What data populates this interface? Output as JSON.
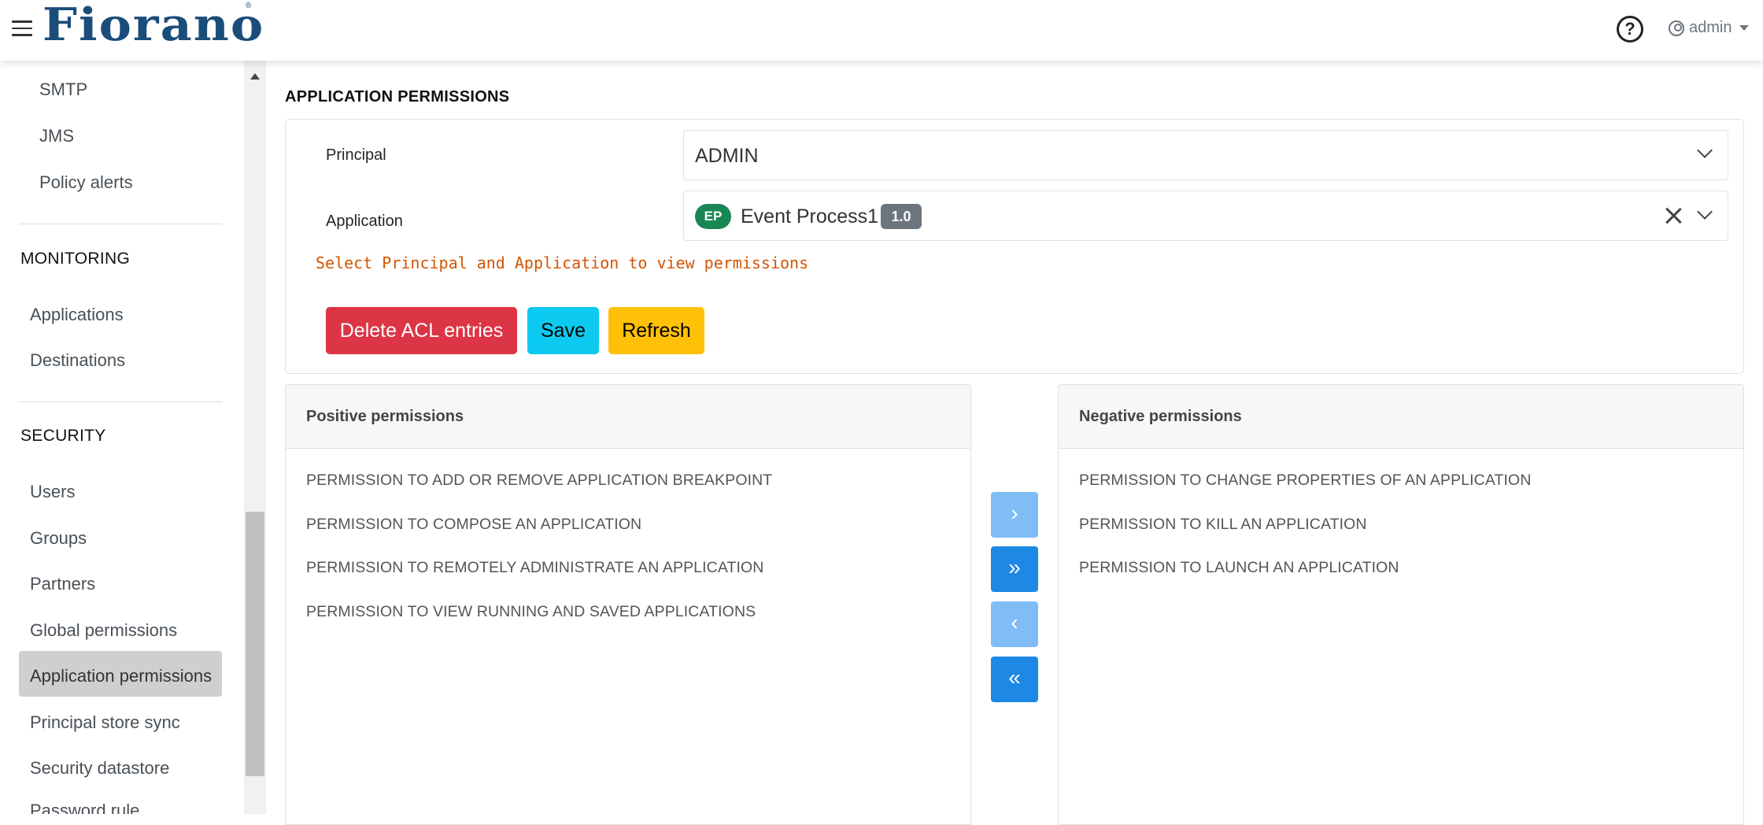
{
  "header": {
    "logo_text": "Fiorano",
    "logo_mark": "®",
    "help_icon_glyph": "?",
    "user_label": "admin"
  },
  "sidebar": {
    "items_top": [
      "SMTP",
      "JMS",
      "Policy alerts"
    ],
    "monitoring_heading": "MONITORING",
    "monitoring_items": [
      "Applications",
      "Destinations"
    ],
    "security_heading": "SECURITY",
    "security_items": [
      "Users",
      "Groups",
      "Partners",
      "Global permissions",
      "Application permissions",
      "Principal store sync",
      "Security datastore",
      "Password rule"
    ],
    "active_item": "Application permissions"
  },
  "main": {
    "title": "APPLICATION PERMISSIONS",
    "principal_label": "Principal",
    "principal_value": "ADMIN",
    "application_label": "Application",
    "application_badge": "EP",
    "application_name": "Event Process1",
    "application_version": "1.0",
    "hint": "Select Principal and Application to view permissions",
    "buttons": {
      "delete": "Delete ACL entries",
      "save": "Save",
      "refresh": "Refresh"
    }
  },
  "positive_panel": {
    "title": "Positive permissions",
    "items": [
      "PERMISSION TO ADD OR REMOVE APPLICATION BREAKPOINT",
      "PERMISSION TO COMPOSE AN APPLICATION",
      "PERMISSION TO REMOTELY ADMINISTRATE AN APPLICATION",
      "PERMISSION TO VIEW RUNNING AND SAVED APPLICATIONS"
    ]
  },
  "negative_panel": {
    "title": "Negative permissions",
    "items": [
      "PERMISSION TO CHANGE PROPERTIES OF AN APPLICATION",
      "PERMISSION TO KILL AN APPLICATION",
      "PERMISSION TO LAUNCH AN APPLICATION"
    ]
  },
  "transfer_buttons": {
    "move_right": "›",
    "move_all_right": "»",
    "move_left": "‹",
    "move_all_left": "«"
  },
  "colors": {
    "danger": "#dc3545",
    "info": "#0dcaf0",
    "warning": "#ffc107",
    "success_badge": "#198754",
    "transfer_light": "#80bdf7",
    "transfer_strong": "#1e88e5",
    "hint_text": "#d35400"
  }
}
